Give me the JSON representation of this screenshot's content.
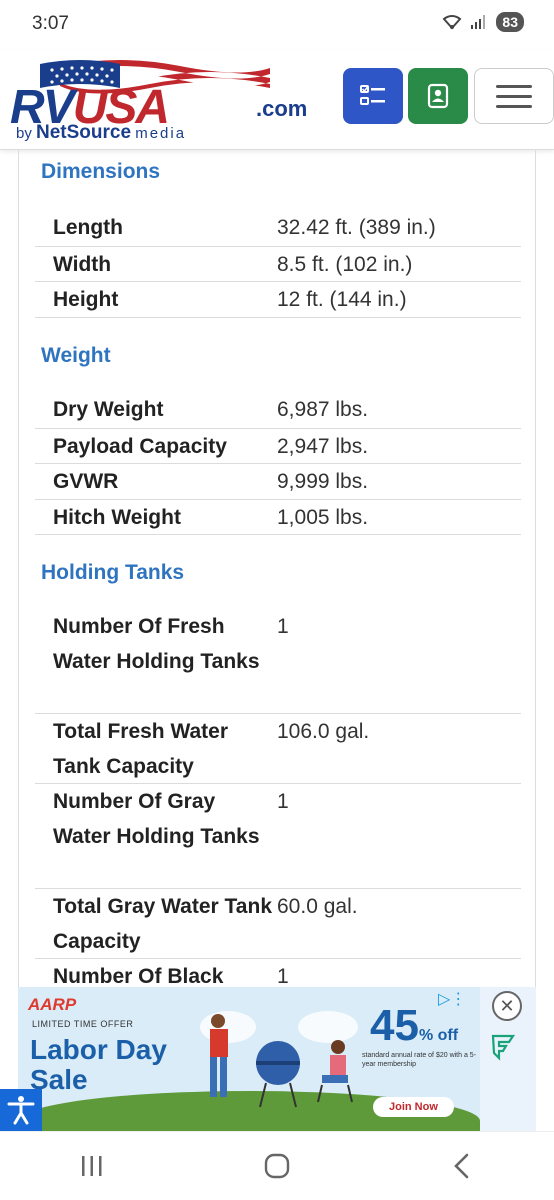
{
  "status": {
    "time": "3:07",
    "battery": "83"
  },
  "header": {
    "logo_rv": "RV",
    "logo_usa": "USA",
    "logo_com": ".com",
    "logo_by": "by",
    "logo_netsource": "NetSource",
    "logo_media": "media"
  },
  "sections": [
    {
      "title": "Dimensions",
      "rows": [
        {
          "label": "Length",
          "value": "32.42 ft. (389 in.)"
        },
        {
          "label": "Width",
          "value": "8.5 ft. (102 in.)"
        },
        {
          "label": "Height",
          "value": "12 ft. (144 in.)"
        }
      ]
    },
    {
      "title": "Weight",
      "rows": [
        {
          "label": "Dry Weight",
          "value": "6,987 lbs."
        },
        {
          "label": "Payload Capacity",
          "value": "2,947 lbs."
        },
        {
          "label": "GVWR",
          "value": "9,999 lbs."
        },
        {
          "label": "Hitch Weight",
          "value": "1,005 lbs."
        }
      ]
    },
    {
      "title": "Holding Tanks",
      "rows": [
        {
          "label": "Number Of Fresh Water Holding Tanks",
          "value": "1"
        },
        {
          "label": "Total Fresh Water Tank Capacity",
          "value": "106.0 gal."
        },
        {
          "label": "Number Of Gray Water Holding Tanks",
          "value": "1"
        },
        {
          "label": "Total Gray Water Tank Capacity",
          "value": "60.0 gal."
        },
        {
          "label": "Number Of Black",
          "value": "1"
        }
      ]
    }
  ],
  "ad": {
    "brand": "AARP",
    "offer": "LIMITED TIME OFFER",
    "headline": "Labor Day Sale",
    "percent": "45",
    "percent_suffix": "% off",
    "fine": "standard annual rate of $20 with a 5-year membership",
    "cta": "Join Now",
    "close": "✕"
  },
  "colors": {
    "accent_blue": "#2f74c0",
    "list_btn": "#2f56c7",
    "contact_btn": "#2a8a48"
  }
}
